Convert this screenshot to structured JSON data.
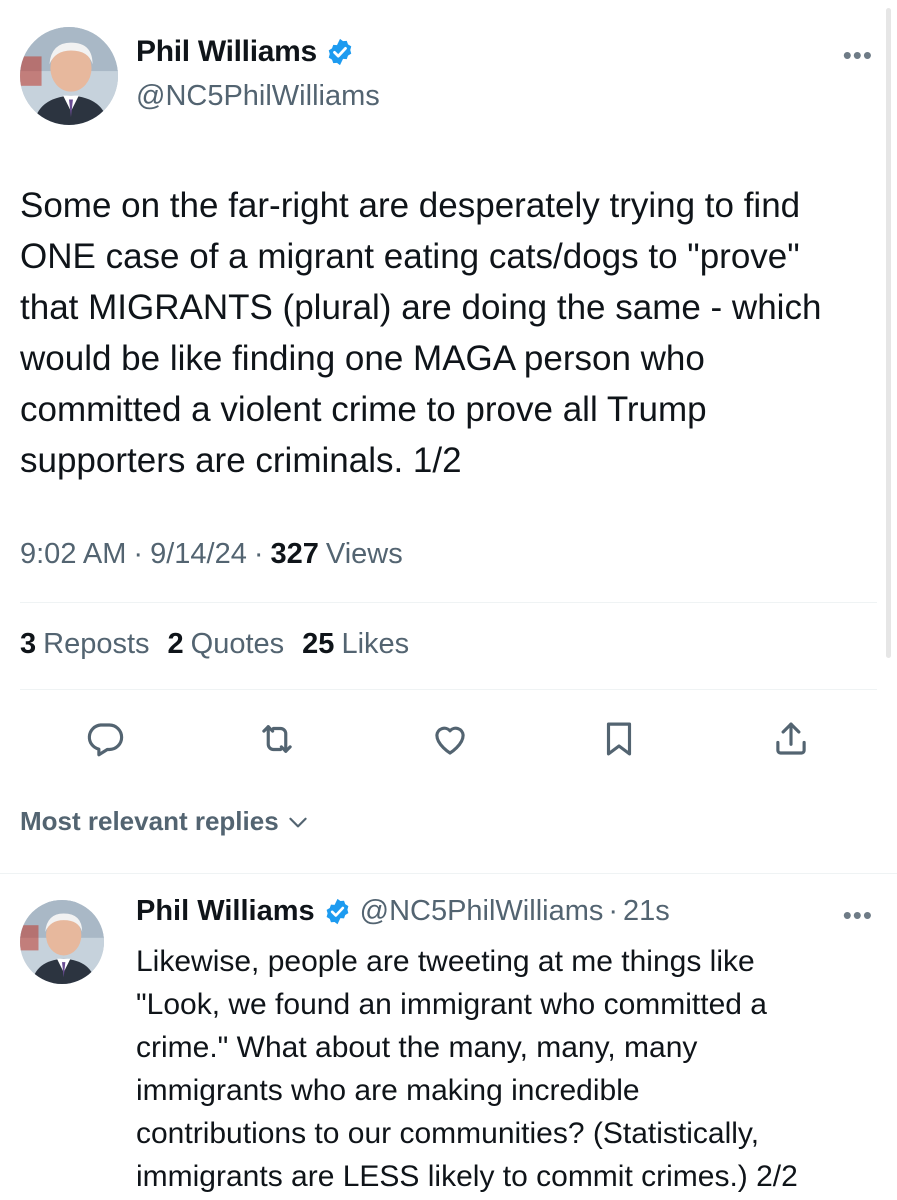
{
  "tweet": {
    "author_name": "Phil Williams",
    "author_handle": "@NC5PhilWilliams",
    "more_label": "•••",
    "text": "Some on the far-right are desperately trying to find\nONE case of a migrant eating cats/dogs to \"prove\"\nthat MIGRANTS (plural) are doing the same - which\nwould be like finding one MAGA person who\ncommitted a violent crime to prove all Trump\nsupporters are criminals. 1/2",
    "time": "9:02 AM",
    "date": "9/14/24",
    "views_count": "327",
    "views_label": "Views",
    "separator": "·"
  },
  "stats": [
    {
      "count": "3",
      "label": "Reposts"
    },
    {
      "count": "2",
      "label": "Quotes"
    },
    {
      "count": "25",
      "label": "Likes"
    }
  ],
  "actions": {
    "icons": [
      "reply-icon",
      "repost-icon",
      "like-icon",
      "bookmark-icon",
      "share-icon"
    ]
  },
  "replies_sort": {
    "label": "Most relevant replies",
    "icon": "chevron-down-icon"
  },
  "reply": {
    "author_name": "Phil Williams",
    "author_handle": "@NC5PhilWilliams",
    "separator": "·",
    "time": "21s",
    "more_label": "•••",
    "text": "Likewise, people are tweeting at me things like\n\"Look, we found an immigrant who committed a\ncrime.\" What about the many, many, many\nimmigrants who are making incredible\ncontributions to our communities? (Statistically,\nimmigrants are LESS likely to commit crimes.) 2/2"
  },
  "colors": {
    "text_primary": "#0f1419",
    "text_secondary": "#536471",
    "verified_blue": "#1d9bf0",
    "divider": "#eff3f4"
  }
}
